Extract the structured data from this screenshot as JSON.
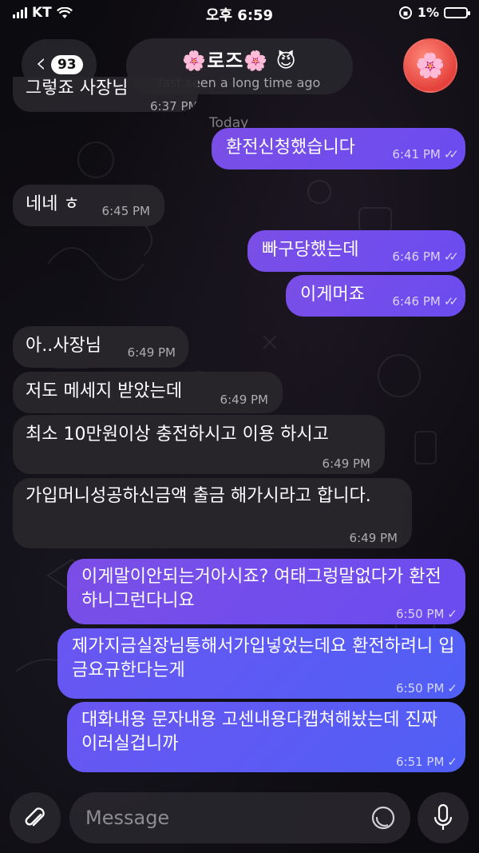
{
  "status_bar": {
    "carrier": "KT",
    "time": "오후 6:59",
    "battery": "1%"
  },
  "header": {
    "unread_count": "93",
    "title": "🌸로즈🌸 😈",
    "subtitle": "last seen a long time ago",
    "avatar_emoji": "🌸"
  },
  "date_separator": "Today",
  "messages": [
    {
      "dir": "in",
      "text": "그렇죠 사장님",
      "time": "6:37 PM"
    },
    {
      "dir": "out",
      "text": "환전신청했습니다",
      "time": "6:41 PM",
      "status": "read"
    },
    {
      "dir": "in",
      "text": "네네 ㅎ",
      "time": "6:45 PM"
    },
    {
      "dir": "out",
      "text": "빠구당했는데",
      "time": "6:46 PM",
      "status": "read"
    },
    {
      "dir": "out",
      "text": "이게머죠",
      "time": "6:46 PM",
      "status": "read"
    },
    {
      "dir": "in",
      "text": "아..사장님",
      "time": "6:49 PM"
    },
    {
      "dir": "in",
      "text": "저도 메세지 받았는데",
      "time": "6:49 PM"
    },
    {
      "dir": "in",
      "text": "최소 10만원이상 충전하시고 이용 하시고",
      "time": "6:49 PM"
    },
    {
      "dir": "in",
      "text": "가입머니성공하신금액 출금 해가시라고 합니다.",
      "time": "6:49 PM"
    },
    {
      "dir": "out",
      "text": "이게말이안되는거아시죠? 여태그렁말없다가 환전하니그런다니요",
      "time": "6:50 PM",
      "status": "sent"
    },
    {
      "dir": "out",
      "text": "제가지금실장님통해서가입넣었는데요 환전하려니 입금요규한다는게",
      "time": "6:50 PM",
      "status": "sent"
    },
    {
      "dir": "out",
      "text": "대화내용 문자내용 고센내용다캡쳐해놨는데 진짜 이러실겁니까",
      "time": "6:51 PM",
      "status": "sent"
    }
  ],
  "composer": {
    "placeholder": "Message"
  },
  "colors": {
    "outgoing_bubble": "#7b4ee6",
    "outgoing_bubble_late": "#5a5cf4",
    "incoming_bubble": "#28252c",
    "background": "#0c0b0f"
  }
}
